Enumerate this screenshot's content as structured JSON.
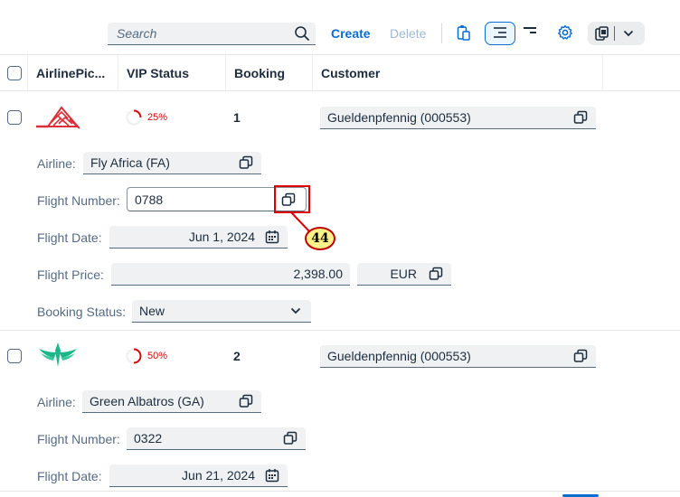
{
  "toolbar": {
    "search_placeholder": "Search",
    "create_label": "Create",
    "delete_label": "Delete",
    "icons": [
      "search-icon",
      "paste-icon",
      "show-details-icon",
      "hide-details-icon",
      "settings-icon",
      "export-icon",
      "chevron-down-icon"
    ]
  },
  "table": {
    "headers": [
      "AirlinePic...",
      "VIP Status",
      "Booking",
      "Customer"
    ]
  },
  "rows": [
    {
      "vip_percent": "25%",
      "vip_fraction": 0.25,
      "booking": "1",
      "customer": "Gueldenpfennig (000553)",
      "labels": {
        "airline": "Airline:",
        "flight_number": "Flight Number:",
        "flight_date": "Flight Date:",
        "flight_price": "Flight Price:",
        "booking_status": "Booking Status:"
      },
      "airline": "Fly Africa (FA)",
      "flight_number": "0788",
      "flight_date": "Jun 1, 2024",
      "flight_price": "2,398.00",
      "currency": "EUR",
      "booking_status": "New"
    },
    {
      "vip_percent": "50%",
      "vip_fraction": 0.5,
      "booking": "2",
      "customer": "Gueldenpfennig (000553)",
      "labels": {
        "airline": "Airline:",
        "flight_number": "Flight Number:",
        "flight_date": "Flight Date:"
      },
      "airline": "Green Albatros (GA)",
      "flight_number": "0322",
      "flight_date": "Jun 21, 2024"
    }
  ],
  "annotation": {
    "label": "44"
  },
  "colors": {
    "accent": "#0a6ed1",
    "vip_red": "#d20a0a",
    "annotation_red": "#e00000",
    "badge_yellow": "#fff38a"
  }
}
